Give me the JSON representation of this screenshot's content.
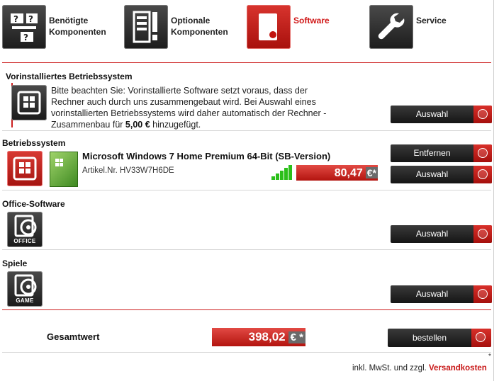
{
  "tabs": [
    {
      "label_line1": "Benötigte",
      "label_line2": "Komponenten",
      "icon": "question-monitor-icon",
      "active": false
    },
    {
      "label_line1": "Optionale",
      "label_line2": "Komponenten",
      "icon": "pc-tower-icon",
      "active": false
    },
    {
      "label_line1": "Software",
      "label_line2": "",
      "icon": "software-box-icon",
      "active": true
    },
    {
      "label_line1": "Service",
      "label_line2": "",
      "icon": "wrench-icon",
      "active": false
    }
  ],
  "preinstalled": {
    "title": "Vorinstalliertes Betriebssystem",
    "notice_line1": "Bitte beachten Sie: Vorinstallierte Software setzt voraus, dass der",
    "notice_line2": "Rechner auch durch uns zusammengebaut wird. Bei Auswahl eines",
    "notice_line3": "vorinstallierten Betriebssystems wird daher automatisch der Rechner -",
    "notice_line4a": "Zusammenbau für ",
    "notice_price": "5,00 €",
    "notice_line4b": " hinzugefügt.",
    "button": "Auswahl"
  },
  "os": {
    "title": "Betriebssystem",
    "product_name": "Microsoft Windows 7 Home Premium 64-Bit (SB-Version)",
    "article": "Artikel.Nr. HV33W7H6DE",
    "price": "80,47",
    "currency": "€*",
    "remove_button": "Entfernen",
    "select_button": "Auswahl",
    "stock_level": 5
  },
  "office": {
    "title": "Office-Software",
    "icon_caption": "OFFICE",
    "button": "Auswahl"
  },
  "games": {
    "title": "Spiele",
    "icon_caption": "GAME",
    "button": "Auswahl"
  },
  "total": {
    "label": "Gesamtwert",
    "price": "398,02",
    "currency": "€ *",
    "order_button": "bestellen"
  },
  "footer": {
    "asterisk": "*",
    "tax_text": "inkl. MwSt. und zzgl. ",
    "shipping_link": "Versandkosten"
  },
  "colors": {
    "accent": "#cc1f1f",
    "dark": "#1c1c1c",
    "stock": "#2bbf1a"
  }
}
